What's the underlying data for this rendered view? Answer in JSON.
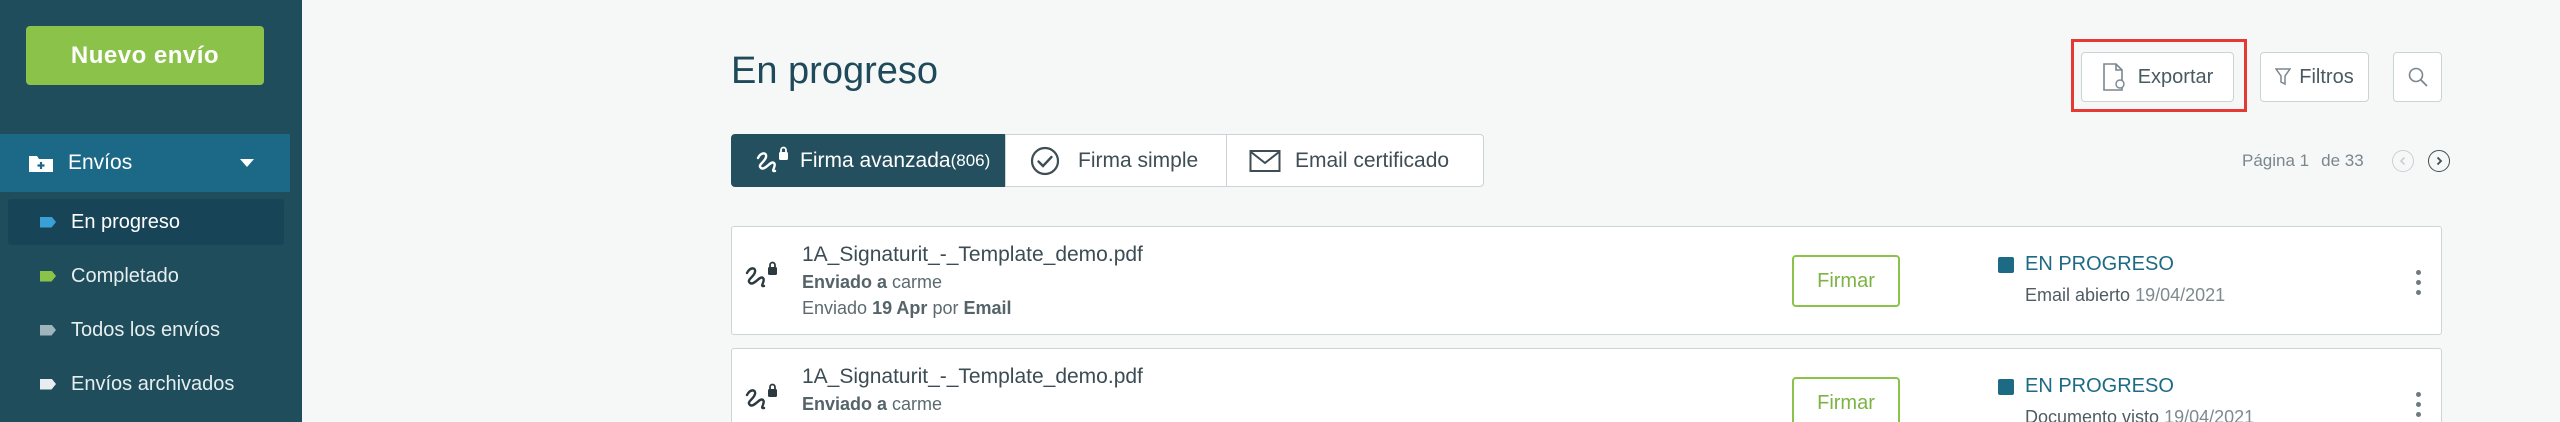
{
  "sidebar": {
    "new_button": "Nuevo envío",
    "section": "Envíos",
    "items": [
      {
        "label": "En progreso",
        "color": "#3aa0d8",
        "active": true
      },
      {
        "label": "Completado",
        "color": "#8bc34a",
        "active": false
      },
      {
        "label": "Todos los envíos",
        "color": "#9fb4bd",
        "active": false
      },
      {
        "label": "Envíos archivados",
        "color": "#e8eef0",
        "active": false
      }
    ]
  },
  "header": {
    "title": "En progreso",
    "export_label": "Exportar",
    "filters_label": "Filtros"
  },
  "tabs": [
    {
      "label": "Firma avanzada",
      "count": "(806)",
      "icon": "signature-lock-icon",
      "active": true
    },
    {
      "label": "Firma simple",
      "icon": "check-circle-icon",
      "active": false
    },
    {
      "label": "Email certificado",
      "icon": "envelope-icon",
      "active": false
    }
  ],
  "pagination": {
    "page_label": "Página 1",
    "of_label": "de 33"
  },
  "documents": [
    {
      "filename": "1A_Signaturit_-_Template_demo.pdf",
      "sent_to_label": "Enviado a",
      "recipient": "carme",
      "sent_prefix": "Enviado",
      "sent_date": "19 Apr",
      "by_label": "por",
      "channel": "Email",
      "action_label": "Firmar",
      "status": "EN PROGRESO",
      "status_detail": "Email abierto",
      "status_date": "19/04/2021"
    },
    {
      "filename": "1A_Signaturit_-_Template_demo.pdf",
      "sent_to_label": "Enviado a",
      "recipient": "carme",
      "action_label": "Firmar",
      "status": "EN PROGRESO",
      "status_detail": "Documento visto",
      "status_date": "19/04/2021"
    }
  ],
  "colors": {
    "sidebar_bg": "#1f4d5c",
    "accent_green": "#8bc34a",
    "accent_blue": "#1d6a85",
    "highlight_red": "#e53935"
  }
}
